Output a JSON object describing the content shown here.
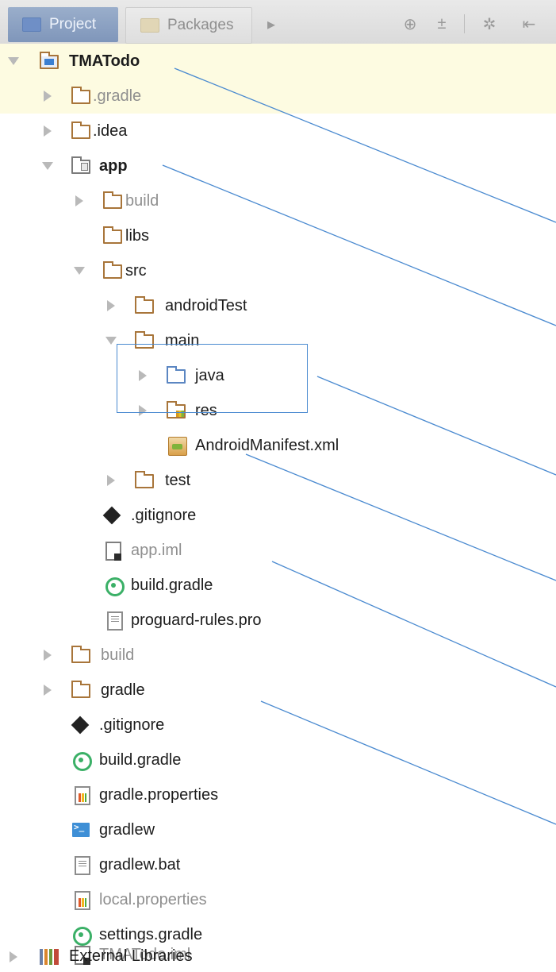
{
  "toolbar": {
    "tabs": [
      {
        "label": "Project",
        "active": true
      },
      {
        "label": "Packages",
        "active": false
      }
    ],
    "icons": [
      "more-arrow-icon",
      "target-icon",
      "collapse-icon",
      "gear-icon",
      "hide-icon"
    ]
  },
  "tree": {
    "root": {
      "label": "TMATodo"
    },
    "gradle_dir": {
      "label": ".gradle"
    },
    "idea_dir": {
      "label": ".idea"
    },
    "app": {
      "label": "app",
      "build": {
        "label": "build"
      },
      "libs": {
        "label": "libs"
      },
      "src": {
        "label": "src",
        "androidTest": {
          "label": "androidTest"
        },
        "main": {
          "label": "main",
          "java": {
            "label": "java"
          },
          "res": {
            "label": "res"
          },
          "manifest": {
            "label": "AndroidManifest.xml"
          }
        },
        "test": {
          "label": "test"
        }
      },
      "gitignore": {
        "label": ".gitignore"
      },
      "iml": {
        "label": "app.iml"
      },
      "build_gradle": {
        "label": "build.gradle"
      },
      "proguard": {
        "label": "proguard-rules.pro"
      }
    },
    "build_dir": {
      "label": "build"
    },
    "gradle_wrapper_dir": {
      "label": "gradle"
    },
    "gitignore": {
      "label": ".gitignore"
    },
    "build_gradle": {
      "label": "build.gradle"
    },
    "gradle_properties": {
      "label": "gradle.properties"
    },
    "gradlew": {
      "label": "gradlew"
    },
    "gradlew_bat": {
      "label": "gradlew.bat"
    },
    "local_properties": {
      "label": "local.properties"
    },
    "settings_gradle": {
      "label": "settings.gradle"
    },
    "root_iml": {
      "label": "TMATodo.iml"
    },
    "external_libraries": {
      "label": "External Libraries"
    }
  },
  "colors": {
    "selection": "#fdfbe1",
    "callout_line": "#4a8ad0",
    "folder": "#a8753a",
    "source_folder": "#5b86c2"
  }
}
